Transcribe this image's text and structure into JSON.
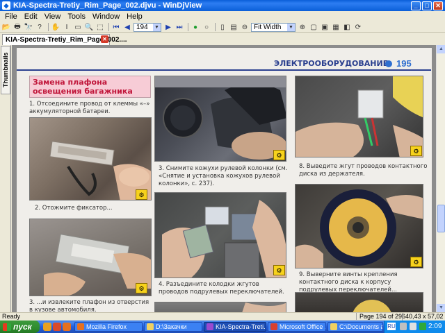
{
  "window": {
    "title": "KIA-Spectra-Tretiy_Rim_Page_002.djvu - WinDjView",
    "app_icon": "djvu-icon"
  },
  "menu": [
    "File",
    "Edit",
    "View",
    "Tools",
    "Window",
    "Help"
  ],
  "toolbar": {
    "page_value": "194",
    "zoom_value": "Fit Width"
  },
  "tab": {
    "label": "KIA-Spectra-Tretiy_Rim_Page_002...."
  },
  "sidebar": {
    "thumbnails_label": "Thumbnails"
  },
  "document": {
    "header": {
      "title": "ЭЛЕКТРООБОРУДОВАНИЕ",
      "page_number": "195"
    },
    "section": {
      "title_line1": "Замена плафона",
      "title_line2": "освещения багажника"
    },
    "captions": {
      "c1": "1. Отсоедините провод от клеммы «–» аккумуляторной батареи.",
      "c2": "2. Отожмите фиксатор...",
      "c3": "3. ...и извлеките плафон из отверстия в кузове автомобиля.",
      "c4": "3. Снимите кожухи рулевой колонки (см. «Снятие и установка кожухов рулевой колонки», с. 237).",
      "c5": "4. Разъедините колодки жгутов проводов подрулевых переключателей.",
      "c6": "8. Выведите жгут проводов контактного диска из держателя.",
      "c7": "9. Выверните винты крепления контактного диска к корпусу подрулевых переключателей..."
    }
  },
  "statusbar": {
    "status": "Ready",
    "page_info": "Page 194 of 296",
    "size_info": "40,43 x 57,02 cm"
  },
  "taskbar": {
    "start_label": "пуск",
    "tasks": [
      "Mozilla Firefox",
      "D:\\Закачки",
      "KIA-Spectra-Treti...",
      "Microsoft Office ...",
      "C:\\Documents an..."
    ],
    "lang": "RU",
    "clock": "2:09"
  },
  "colors": {
    "title_bar": "#0a5fd8",
    "header_blue": "#2a3f8f",
    "section_red": "#c0163a",
    "section_bg": "#f7ccd6",
    "badge_yellow": "#f7d21c"
  }
}
